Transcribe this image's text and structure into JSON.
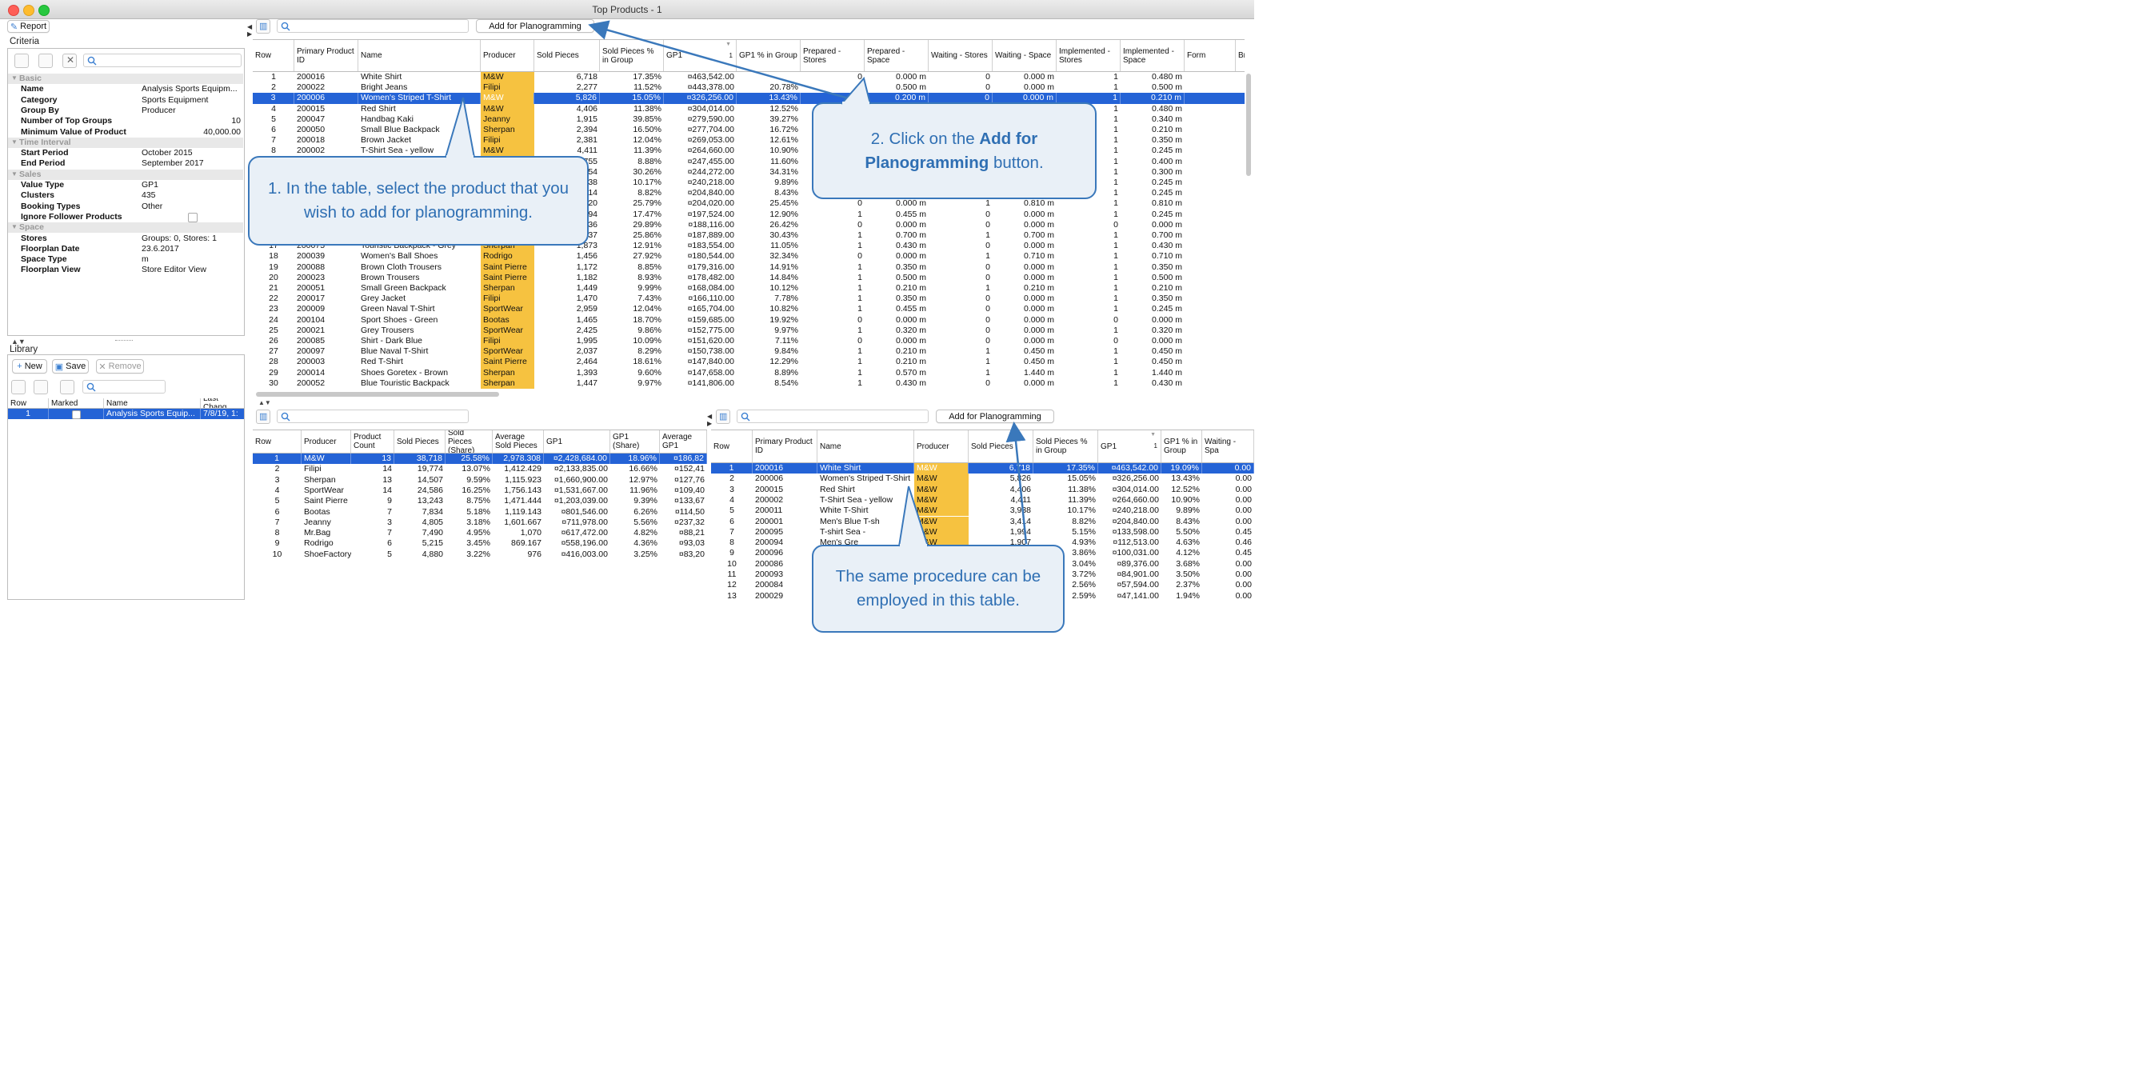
{
  "window": {
    "title": "Top Products - 1"
  },
  "toolbar": {
    "report_label": "Report"
  },
  "criteria": {
    "title": "Criteria",
    "sections": [
      {
        "name": "Basic",
        "rows": [
          [
            "Name",
            "Analysis Sports Equipm..."
          ],
          [
            "Category",
            "Sports Equipment"
          ],
          [
            "Group By",
            "Producer"
          ],
          [
            "Number of Top Groups",
            "10"
          ],
          [
            "Minimum Value of Product",
            "40,000.00"
          ]
        ]
      },
      {
        "name": "Time Interval",
        "rows": [
          [
            "Start Period",
            "October 2015"
          ],
          [
            "End Period",
            "September 2017"
          ]
        ]
      },
      {
        "name": "Sales",
        "rows": [
          [
            "Value Type",
            "GP1"
          ],
          [
            "Clusters",
            "435"
          ],
          [
            "Booking Types",
            "Other"
          ],
          [
            "Ignore Follower Products",
            ""
          ]
        ]
      },
      {
        "name": "Space",
        "rows": [
          [
            "Stores",
            "Groups: 0, Stores: 1"
          ],
          [
            "Floorplan Date",
            "23.6.2017"
          ],
          [
            "Space Type",
            "m"
          ],
          [
            "Floorplan View",
            "Store Editor View"
          ]
        ]
      }
    ]
  },
  "library": {
    "title": "Library",
    "new_label": "New",
    "save_label": "Save",
    "remove_label": "Remove",
    "headers": [
      "Row",
      "Marked",
      "Name",
      "Last Chang"
    ],
    "rows": [
      [
        "1",
        "",
        "Analysis Sports Equip...",
        "7/8/19, 1:"
      ]
    ]
  },
  "top": {
    "add_button": "Add for Planogramming",
    "headers": [
      "Row",
      "Primary Product ID",
      "Name",
      "Producer",
      "Sold Pieces",
      "Sold Pieces % in Group",
      "GP1",
      "GP1 % in Group",
      "Prepared - Stores",
      "Prepared - Space",
      "Waiting - Stores",
      "Waiting - Space",
      "Implemented - Stores",
      "Implemented - Space",
      "Form",
      "Br"
    ],
    "gp1_sort_index": "1",
    "rows": [
      [
        "1",
        "200016",
        "White Shirt",
        "M&W",
        "6,718",
        "17.35%",
        "¤463,542.00",
        "",
        "0",
        "0.000 m",
        "0",
        "0.000 m",
        "1",
        "0.480 m"
      ],
      [
        "2",
        "200022",
        "Bright Jeans",
        "Filipi",
        "2,277",
        "11.52%",
        "¤443,378.00",
        "20.78%",
        "1",
        "0.500 m",
        "0",
        "0.000 m",
        "1",
        "0.500 m"
      ],
      [
        "3",
        "200006",
        "Women's Striped T-Shirt",
        "M&W",
        "5,826",
        "15.05%",
        "¤326,256.00",
        "13.43%",
        "1",
        "0.200 m",
        "0",
        "0.000 m",
        "1",
        "0.210 m"
      ],
      [
        "4",
        "200015",
        "Red Shirt",
        "M&W",
        "4,406",
        "11.38%",
        "¤304,014.00",
        "12.52%",
        "",
        "",
        "",
        "",
        "1",
        "0.480 m"
      ],
      [
        "5",
        "200047",
        "Handbag Kaki",
        "Jeanny",
        "1,915",
        "39.85%",
        "¤279,590.00",
        "39.27%",
        "",
        "",
        "",
        "",
        "1",
        "0.340 m"
      ],
      [
        "6",
        "200050",
        "Small Blue Backpack",
        "Sherpan",
        "2,394",
        "16.50%",
        "¤277,704.00",
        "16.72%",
        "",
        "",
        "",
        "",
        "1",
        "0.210 m"
      ],
      [
        "7",
        "200018",
        "Brown Jacket",
        "Filipi",
        "2,381",
        "12.04%",
        "¤269,053.00",
        "12.61%",
        "",
        "",
        "",
        "",
        "1",
        "0.350 m"
      ],
      [
        "8",
        "200002",
        "T-Shirt Sea - yellow",
        "M&W",
        "4,411",
        "11.39%",
        "¤264,660.00",
        "10.90%",
        "",
        "",
        "",
        "",
        "1",
        "0.245 m"
      ],
      [
        "9",
        "",
        "",
        "",
        "1,755",
        "8.88%",
        "¤247,455.00",
        "11.60%",
        "",
        "",
        "",
        "",
        "1",
        "0.400 m"
      ],
      [
        "10",
        "",
        "",
        "",
        "1,554",
        "30.26%",
        "¤244,272.00",
        "34.31%",
        "",
        "",
        "",
        "",
        "1",
        "0.300 m"
      ],
      [
        "11",
        "",
        "",
        "",
        "3,938",
        "10.17%",
        "¤240,218.00",
        "9.89%",
        "",
        "",
        "",
        "",
        "1",
        "0.245 m"
      ],
      [
        "12",
        "",
        "",
        "",
        "3,414",
        "8.82%",
        "¤204,840.00",
        "8.43%",
        "",
        "",
        "",
        "",
        "1",
        "0.245 m"
      ],
      [
        "13",
        "",
        "",
        "",
        "1,320",
        "25.79%",
        "¤204,020.00",
        "25.45%",
        "0",
        "0.000 m",
        "1",
        "0.810 m",
        "1",
        "0.810 m"
      ],
      [
        "14",
        "",
        "",
        "",
        "2,094",
        "17.47%",
        "¤197,524.00",
        "12.90%",
        "1",
        "0.455 m",
        "0",
        "0.000 m",
        "1",
        "0.245 m"
      ],
      [
        "15",
        "",
        "",
        "",
        "1,536",
        "29.89%",
        "¤188,116.00",
        "26.42%",
        "0",
        "0.000 m",
        "0",
        "0.000 m",
        "0",
        "0.000 m"
      ],
      [
        "16",
        "",
        "",
        "",
        "1,337",
        "25.86%",
        "¤187,889.00",
        "30.43%",
        "1",
        "0.700 m",
        "1",
        "0.700 m",
        "1",
        "0.700 m"
      ],
      [
        "17",
        "200075",
        "Touristic Backpack - Grey",
        "Sherpan",
        "1,873",
        "12.91%",
        "¤183,554.00",
        "11.05%",
        "1",
        "0.430 m",
        "0",
        "0.000 m",
        "1",
        "0.430 m"
      ],
      [
        "18",
        "200039",
        "Women's Ball Shoes",
        "Rodrigo",
        "1,456",
        "27.92%",
        "¤180,544.00",
        "32.34%",
        "0",
        "0.000 m",
        "1",
        "0.710 m",
        "1",
        "0.710 m"
      ],
      [
        "19",
        "200088",
        "Brown Cloth Trousers",
        "Saint Pierre",
        "1,172",
        "8.85%",
        "¤179,316.00",
        "14.91%",
        "1",
        "0.350 m",
        "0",
        "0.000 m",
        "1",
        "0.350 m"
      ],
      [
        "20",
        "200023",
        "Brown Trousers",
        "Saint Pierre",
        "1,182",
        "8.93%",
        "¤178,482.00",
        "14.84%",
        "1",
        "0.500 m",
        "0",
        "0.000 m",
        "1",
        "0.500 m"
      ],
      [
        "21",
        "200051",
        "Small Green Backpack",
        "Sherpan",
        "1,449",
        "9.99%",
        "¤168,084.00",
        "10.12%",
        "1",
        "0.210 m",
        "1",
        "0.210 m",
        "1",
        "0.210 m"
      ],
      [
        "22",
        "200017",
        "Grey Jacket",
        "Filipi",
        "1,470",
        "7.43%",
        "¤166,110.00",
        "7.78%",
        "1",
        "0.350 m",
        "0",
        "0.000 m",
        "1",
        "0.350 m"
      ],
      [
        "23",
        "200009",
        "Green Naval T-Shirt",
        "SportWear",
        "2,959",
        "12.04%",
        "¤165,704.00",
        "10.82%",
        "1",
        "0.455 m",
        "0",
        "0.000 m",
        "1",
        "0.245 m"
      ],
      [
        "24",
        "200104",
        "Sport Shoes - Green",
        "Bootas",
        "1,465",
        "18.70%",
        "¤159,685.00",
        "19.92%",
        "0",
        "0.000 m",
        "0",
        "0.000 m",
        "0",
        "0.000 m"
      ],
      [
        "25",
        "200021",
        "Grey Trousers",
        "SportWear",
        "2,425",
        "9.86%",
        "¤152,775.00",
        "9.97%",
        "1",
        "0.320 m",
        "0",
        "0.000 m",
        "1",
        "0.320 m"
      ],
      [
        "26",
        "200085",
        "Shirt - Dark Blue",
        "Filipi",
        "1,995",
        "10.09%",
        "¤151,620.00",
        "7.11%",
        "0",
        "0.000 m",
        "0",
        "0.000 m",
        "0",
        "0.000 m"
      ],
      [
        "27",
        "200097",
        "Blue Naval T-Shirt",
        "SportWear",
        "2,037",
        "8.29%",
        "¤150,738.00",
        "9.84%",
        "1",
        "0.210 m",
        "1",
        "0.450 m",
        "1",
        "0.450 m"
      ],
      [
        "28",
        "200003",
        "Red T-Shirt",
        "Saint Pierre",
        "2,464",
        "18.61%",
        "¤147,840.00",
        "12.29%",
        "1",
        "0.210 m",
        "1",
        "0.450 m",
        "1",
        "0.450 m"
      ],
      [
        "29",
        "200014",
        "Shoes Goretex - Brown",
        "Sherpan",
        "1,393",
        "9.60%",
        "¤147,658.00",
        "8.89%",
        "1",
        "0.570 m",
        "1",
        "1.440 m",
        "1",
        "1.440 m"
      ],
      [
        "30",
        "200052",
        "Blue Touristic Backpack",
        "Sherpan",
        "1,447",
        "9.97%",
        "¤141,806.00",
        "8.54%",
        "1",
        "0.430 m",
        "0",
        "0.000 m",
        "1",
        "0.430 m"
      ]
    ]
  },
  "bottom_left": {
    "headers": [
      "Row",
      "Producer",
      "Product Count",
      "Sold Pieces",
      "Sold Pieces (Share)",
      "Average Sold Pieces",
      "GP1",
      "GP1 (Share)",
      "Average GP1"
    ],
    "rows": [
      [
        "1",
        "M&W",
        "13",
        "38,718",
        "25.58%",
        "2,978.308",
        "¤2,428,684.00",
        "18.96%",
        "¤186,82"
      ],
      [
        "2",
        "Filipi",
        "14",
        "19,774",
        "13.07%",
        "1,412.429",
        "¤2,133,835.00",
        "16.66%",
        "¤152,41"
      ],
      [
        "3",
        "Sherpan",
        "13",
        "14,507",
        "9.59%",
        "1,115.923",
        "¤1,660,900.00",
        "12.97%",
        "¤127,76"
      ],
      [
        "4",
        "SportWear",
        "14",
        "24,586",
        "16.25%",
        "1,756.143",
        "¤1,531,667.00",
        "11.96%",
        "¤109,40"
      ],
      [
        "5",
        "Saint Pierre",
        "9",
        "13,243",
        "8.75%",
        "1,471.444",
        "¤1,203,039.00",
        "9.39%",
        "¤133,67"
      ],
      [
        "6",
        "Bootas",
        "7",
        "7,834",
        "5.18%",
        "1,119.143",
        "¤801,546.00",
        "6.26%",
        "¤114,50"
      ],
      [
        "7",
        "Jeanny",
        "3",
        "4,805",
        "3.18%",
        "1,601.667",
        "¤711,978.00",
        "5.56%",
        "¤237,32"
      ],
      [
        "8",
        "Mr.Bag",
        "7",
        "7,490",
        "4.95%",
        "1,070",
        "¤617,472.00",
        "4.82%",
        "¤88,21"
      ],
      [
        "9",
        "Rodrigo",
        "6",
        "5,215",
        "3.45%",
        "869.167",
        "¤558,196.00",
        "4.36%",
        "¤93,03"
      ],
      [
        "10",
        "ShoeFactory",
        "5",
        "4,880",
        "3.22%",
        "976",
        "¤416,003.00",
        "3.25%",
        "¤83,20"
      ]
    ]
  },
  "bottom_right": {
    "add_button": "Add for Planogramming",
    "gp1_sort_index": "1",
    "headers": [
      "Row",
      "Primary Product ID",
      "Name",
      "Producer",
      "Sold Pieces",
      "Sold Pieces % in Group",
      "GP1",
      "GP1 % in Group",
      "Waiting - Spa"
    ],
    "rows": [
      [
        "1",
        "200016",
        "White Shirt",
        "M&W",
        "6,718",
        "17.35%",
        "¤463,542.00",
        "19.09%",
        "0.00"
      ],
      [
        "2",
        "200006",
        "Women's Striped T-Shirt",
        "M&W",
        "5,826",
        "15.05%",
        "¤326,256.00",
        "13.43%",
        "0.00"
      ],
      [
        "3",
        "200015",
        "Red Shirt",
        "M&W",
        "4,406",
        "11.38%",
        "¤304,014.00",
        "12.52%",
        "0.00"
      ],
      [
        "4",
        "200002",
        "T-Shirt Sea - yellow",
        "M&W",
        "4,411",
        "11.39%",
        "¤264,660.00",
        "10.90%",
        "0.00"
      ],
      [
        "5",
        "200011",
        "White T-Shirt",
        "M&W",
        "3,938",
        "10.17%",
        "¤240,218.00",
        "9.89%",
        "0.00"
      ],
      [
        "6",
        "200001",
        "Men's Blue T-sh",
        "M&W",
        "3,414",
        "8.82%",
        "¤204,840.00",
        "8.43%",
        "0.00"
      ],
      [
        "7",
        "200095",
        "T-shirt Sea -",
        "M&W",
        "1,994",
        "5.15%",
        "¤133,598.00",
        "5.50%",
        "0.45"
      ],
      [
        "8",
        "200094",
        "Men's Gre",
        "M&W",
        "1,907",
        "4.93%",
        "¤112,513.00",
        "4.63%",
        "0.46"
      ],
      [
        "9",
        "200096",
        "",
        "",
        "",
        "3.86%",
        "¤100,031.00",
        "4.12%",
        "0.45"
      ],
      [
        "10",
        "200086",
        "",
        "",
        "",
        "3.04%",
        "¤89,376.00",
        "3.68%",
        "0.00"
      ],
      [
        "11",
        "200093",
        "",
        "",
        "",
        "3.72%",
        "¤84,901.00",
        "3.50%",
        "0.00"
      ],
      [
        "12",
        "200084",
        "",
        "",
        "",
        "2.56%",
        "¤57,594.00",
        "2.37%",
        "0.00"
      ],
      [
        "13",
        "200029",
        "",
        "",
        "",
        "2.59%",
        "¤47,141.00",
        "1.94%",
        "0.00"
      ]
    ]
  },
  "callouts": {
    "c1": "1. In the table, select the product that you wish to add for planogramming.",
    "c2_pre": "2. Click on the ",
    "c2_bold": "Add for Planogramming",
    "c2_post": " button.",
    "c3": "The same procedure can be employed in this table."
  },
  "colors": {
    "selection": "#2463d6",
    "producer_highlight": "#f6c240",
    "callout_border": "#3a78bb",
    "callout_text": "#2f6fb3"
  }
}
